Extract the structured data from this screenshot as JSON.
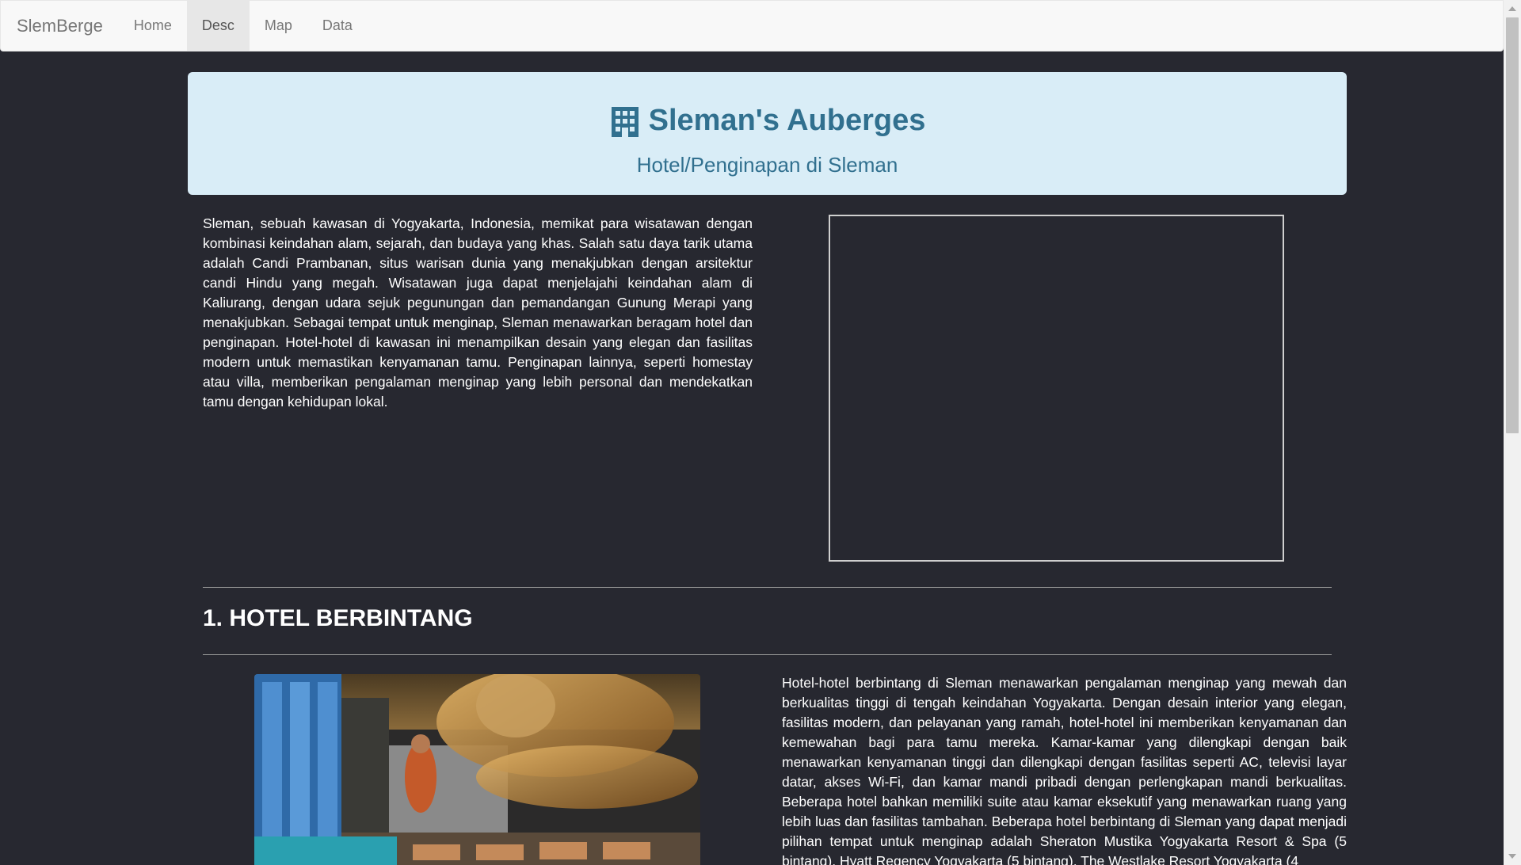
{
  "navbar": {
    "brand": "SlemBerge",
    "items": [
      {
        "label": "Home",
        "active": false
      },
      {
        "label": "Desc",
        "active": true
      },
      {
        "label": "Map",
        "active": false
      },
      {
        "label": "Data",
        "active": false
      }
    ]
  },
  "jumbotron": {
    "icon": "building-icon",
    "title": "Sleman's Auberges",
    "subtitle": "Hotel/Penginapan di Sleman"
  },
  "intro": {
    "text": "Sleman, sebuah kawasan di Yogyakarta, Indonesia, memikat para wisatawan dengan kombinasi keindahan alam, sejarah, dan budaya yang khas. Salah satu daya tarik utama adalah Candi Prambanan, situs warisan dunia yang menakjubkan dengan arsitektur candi Hindu yang megah. Wisatawan juga dapat menjelajahi keindahan alam di Kaliurang, dengan udara sejuk pegunungan dan pemandangan Gunung Merapi yang menakjubkan. Sebagai tempat untuk menginap, Sleman menawarkan beragam hotel dan penginapan. Hotel-hotel di kawasan ini menampilkan desain yang elegan dan fasilitas modern untuk memastikan kenyamanan tamu. Penginapan lainnya, seperti homestay atau villa, memberikan pengalaman menginap yang lebih personal dan mendekatkan tamu dengan kehidupan lokal."
  },
  "section1": {
    "title": "1. HOTEL BERBINTANG",
    "text": "Hotel-hotel berbintang di Sleman menawarkan pengalaman menginap yang mewah dan berkualitas tinggi di tengah keindahan Yogyakarta. Dengan desain interior yang elegan, fasilitas modern, dan pelayanan yang ramah, hotel-hotel ini memberikan kenyamanan dan kemewahan bagi para tamu mereka. Kamar-kamar yang dilengkapi dengan baik menawarkan kenyamanan tinggi dan dilengkapi dengan fasilitas seperti AC, televisi layar datar, akses Wi-Fi, dan kamar mandi pribadi dengan perlengkapan mandi berkualitas. Beberapa hotel bahkan memiliki suite atau kamar eksekutif yang menawarkan ruang yang lebih luas dan fasilitas tambahan. Beberapa hotel berbintang di Sleman yang dapat menjadi pilihan tempat untuk menginap adalah Sheraton Mustika Yogyakarta Resort & Spa (5 bintang), Hyatt Regency Yogyakarta (5 bintang), The Westlake Resort Yogyakarta (4"
  }
}
